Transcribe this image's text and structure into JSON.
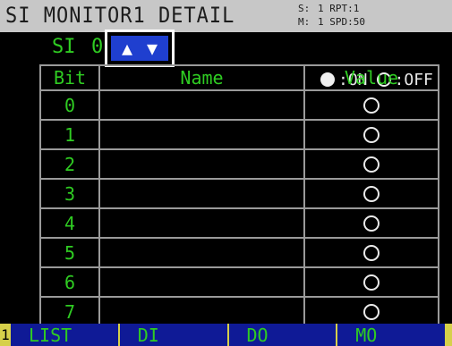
{
  "title": "SI MONITOR1 DETAIL",
  "status": {
    "s_label": "S:",
    "s_value": "1 RPT:1",
    "m_label": "M:",
    "m_value": "1 SPD:50"
  },
  "subheader": {
    "si_label": "SI",
    "group_number": "0"
  },
  "legend": {
    "on_label": ":ON",
    "off_label": ":OFF"
  },
  "table": {
    "headers": [
      "Bit",
      "Name",
      "Value"
    ],
    "rows": [
      {
        "bit": "0",
        "name": "",
        "value": "off"
      },
      {
        "bit": "1",
        "name": "",
        "value": "off"
      },
      {
        "bit": "2",
        "name": "",
        "value": "off"
      },
      {
        "bit": "3",
        "name": "",
        "value": "off"
      },
      {
        "bit": "4",
        "name": "",
        "value": "off"
      },
      {
        "bit": "5",
        "name": "",
        "value": "off"
      },
      {
        "bit": "6",
        "name": "",
        "value": "off"
      },
      {
        "bit": "7",
        "name": "",
        "value": "off"
      }
    ]
  },
  "footer": {
    "page": "1",
    "tabs": [
      "LIST",
      "DI",
      "DO",
      "MO"
    ]
  },
  "colors": {
    "title_bg": "#c7c7c7",
    "label_green": "#2fcc22",
    "footer_blue": "#0f1a96",
    "footer_yellow": "#d6d04a",
    "arrow_blue": "#1f3fcf"
  },
  "icons": [
    "up-arrow-icon",
    "down-arrow-icon",
    "on-indicator-icon",
    "off-indicator-icon"
  ]
}
